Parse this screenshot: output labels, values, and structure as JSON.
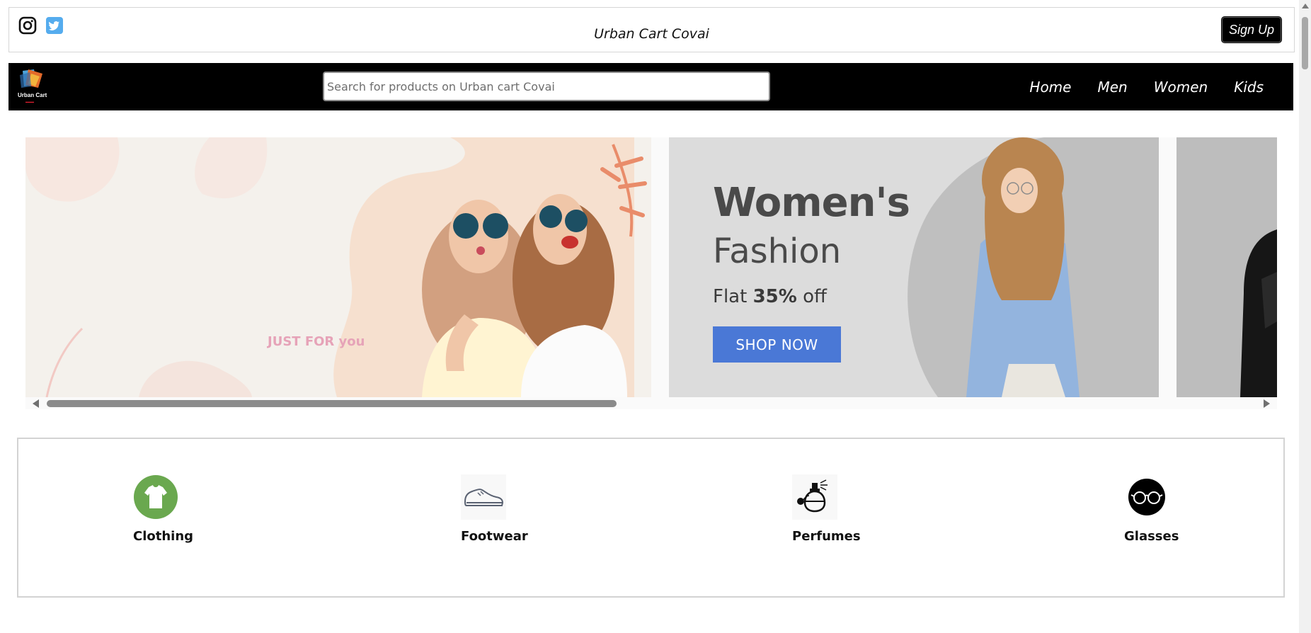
{
  "header": {
    "title": "Urban Cart Covai",
    "signup_label": "Sign Up",
    "social": [
      "instagram-icon",
      "twitter-icon"
    ]
  },
  "navbar": {
    "logo_text": "Urban Cart",
    "search_placeholder": "Search for products on Urban cart Covai",
    "links": [
      "Home",
      "Men",
      "Women",
      "Kids"
    ]
  },
  "carousel": {
    "slide2": {
      "heading": "Women's",
      "subheading": "Fashion",
      "offer_prefix": "Flat",
      "offer_value": "35%",
      "offer_suffix": "off",
      "button_label": "SHOP NOW"
    },
    "slide1_badge": "JUST FOR you"
  },
  "categories": [
    {
      "label": "Clothing",
      "icon": "tshirt-icon"
    },
    {
      "label": "Footwear",
      "icon": "shoe-icon"
    },
    {
      "label": "Perfumes",
      "icon": "perfume-icon"
    },
    {
      "label": "Glasses",
      "icon": "glasses-icon"
    }
  ],
  "colors": {
    "navbar_bg": "#000000",
    "shop_button": "#4a78d6",
    "clothing_icon": "#6aa84f",
    "twitter": "#55acee"
  }
}
